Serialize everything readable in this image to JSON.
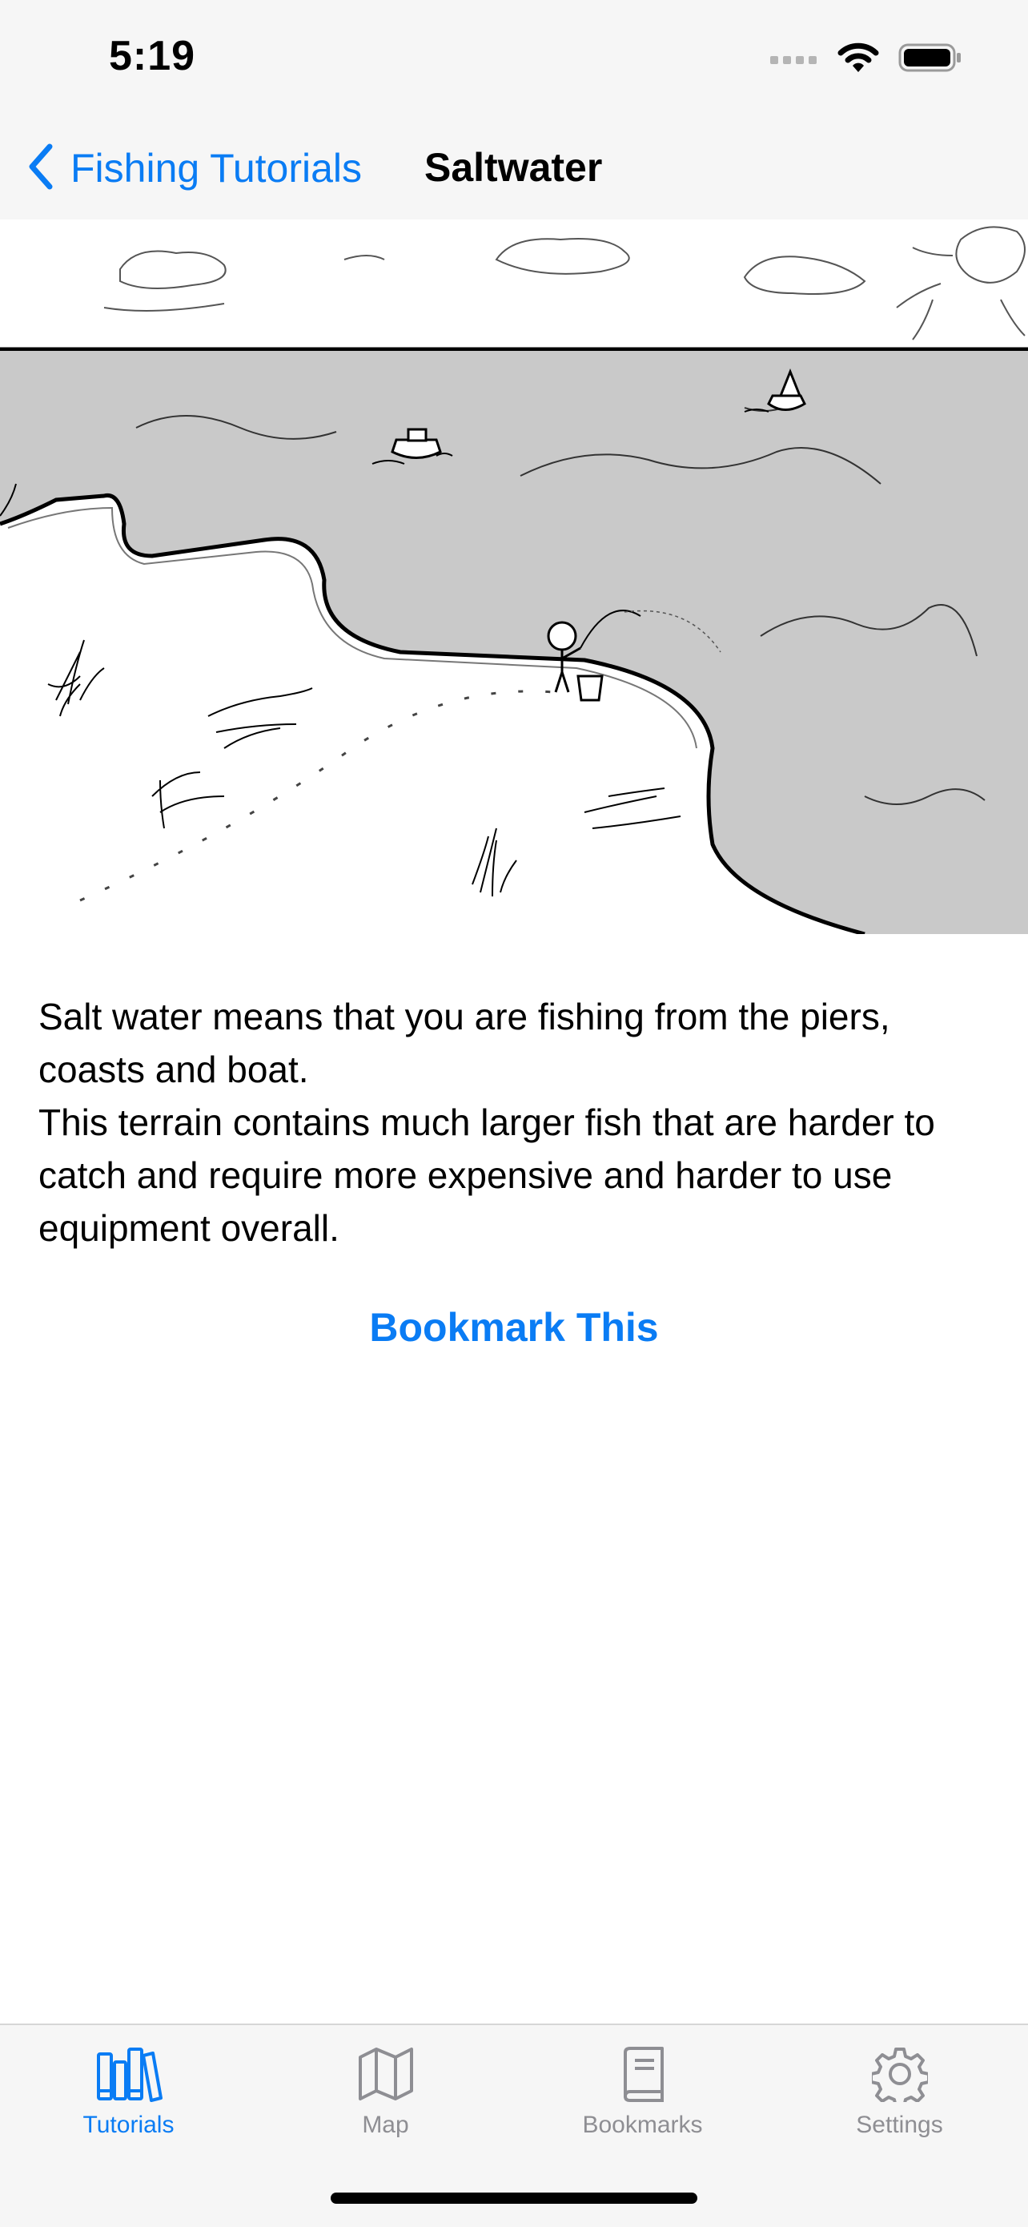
{
  "status_bar": {
    "time": "5:19",
    "icons": [
      "signal-icon",
      "wifi-icon",
      "battery-icon"
    ]
  },
  "nav": {
    "back_label": "Fishing Tutorials",
    "title": "Saltwater"
  },
  "hero": {
    "icon": "saltwater-fishing-illustration"
  },
  "content": {
    "paragraphs": [
      "Salt water means that you are fishing from the piers, coasts and boat.",
      "This terrain contains much larger fish that are harder to catch and require more expensive and harder to use equipment overall."
    ],
    "bookmark_label": "Bookmark This"
  },
  "tab_bar": {
    "tabs": [
      {
        "label": "Tutorials",
        "icon": "books-icon",
        "active": true
      },
      {
        "label": "Map",
        "icon": "map-icon",
        "active": false
      },
      {
        "label": "Bookmarks",
        "icon": "book-icon",
        "active": false
      },
      {
        "label": "Settings",
        "icon": "gear-icon",
        "active": false
      }
    ]
  },
  "colors": {
    "accent": "#0a7cf4",
    "bar_background": "#f6f6f6",
    "inactive_tab": "#8e8e93",
    "water": "#c9c9c9"
  }
}
